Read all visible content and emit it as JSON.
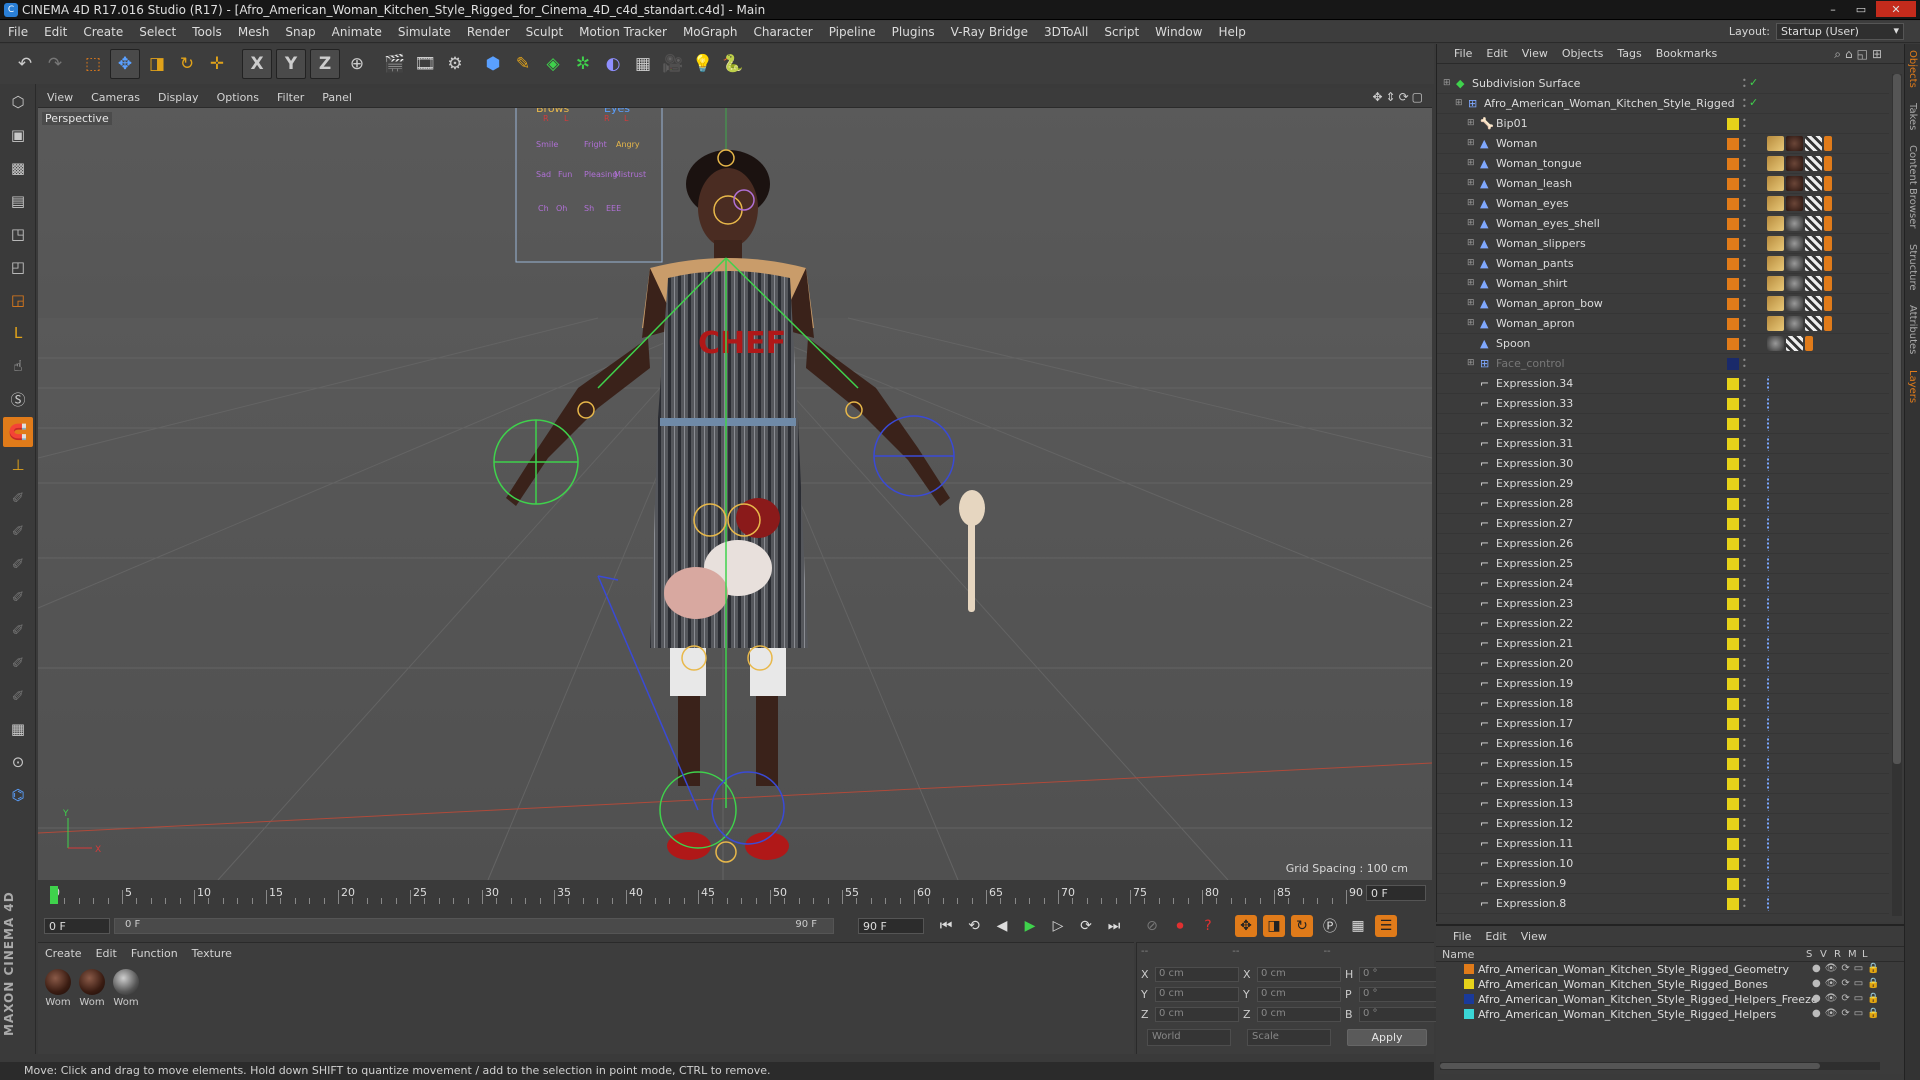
{
  "window": {
    "title": "CINEMA 4D R17.016 Studio (R17) - [Afro_American_Woman_Kitchen_Style_Rigged_for_Cinema_4D_c4d_standart.c4d] - Main"
  },
  "menu": [
    "File",
    "Edit",
    "Create",
    "Select",
    "Tools",
    "Mesh",
    "Snap",
    "Animate",
    "Simulate",
    "Render",
    "Sculpt",
    "Motion Tracker",
    "MoGraph",
    "Character",
    "Pipeline",
    "Plugins",
    "V-Ray Bridge",
    "3DToAll",
    "Script",
    "Window",
    "Help"
  ],
  "layout": {
    "label": "Layout:",
    "value": "Startup (User)"
  },
  "viewport": {
    "menu": [
      "View",
      "Cameras",
      "Display",
      "Options",
      "Filter",
      "Panel"
    ],
    "label": "Perspective",
    "grid_spacing": "Grid Spacing : 100 cm",
    "hud_labels": [
      "Brows",
      "Eyes",
      "R",
      "L",
      "R",
      "L",
      "Smile",
      "Fright",
      "Angry",
      "Sad",
      "Fun",
      "Pleasing",
      "Mistrust",
      "Ch",
      "Oh",
      "Sh",
      "EEE"
    ]
  },
  "timeline": {
    "ticks": [
      "0",
      "5",
      "10",
      "15",
      "20",
      "25",
      "30",
      "35",
      "40",
      "45",
      "50",
      "55",
      "60",
      "65",
      "70",
      "75",
      "80",
      "85",
      "90"
    ],
    "current_frame": "0 F",
    "start_field": "0 F",
    "slider_start": "0 F",
    "slider_end": "90 F",
    "end_field": "90 F"
  },
  "material": {
    "menu": [
      "Create",
      "Edit",
      "Function",
      "Texture"
    ],
    "items": [
      "Wom",
      "Wom",
      "Wom"
    ]
  },
  "coords": {
    "rows": [
      {
        "a": "X",
        "av": "0 cm",
        "b": "X",
        "bv": "0 cm",
        "c": "H",
        "cv": "0 °"
      },
      {
        "a": "Y",
        "av": "0 cm",
        "b": "Y",
        "bv": "0 cm",
        "c": "P",
        "cv": "0 °"
      },
      {
        "a": "Z",
        "av": "0 cm",
        "b": "Z",
        "bv": "0 cm",
        "c": "B",
        "cv": "0 °"
      }
    ],
    "mode": "World",
    "scale": "Scale",
    "apply": "Apply",
    "headers": [
      "--",
      "--",
      "--"
    ]
  },
  "status": "Move: Click and drag to move elements. Hold down SHIFT to quantize movement / add to the selection in point mode, CTRL to remove.",
  "brand": "MAXON CINEMA 4D",
  "objects": {
    "menu": [
      "File",
      "Edit",
      "View",
      "Objects",
      "Tags",
      "Bookmarks"
    ],
    "rows": [
      {
        "name": "Subdivision Surface",
        "indent": 0,
        "icon": "subdivision-icon",
        "color": "",
        "tags": "check"
      },
      {
        "name": "Afro_American_Woman_Kitchen_Style_Rigged",
        "indent": 1,
        "icon": "null-icon",
        "color": "",
        "tags": "check"
      },
      {
        "name": "Bip01",
        "indent": 2,
        "icon": "bone-icon",
        "color": "#e6d21a",
        "tags": ""
      },
      {
        "name": "Woman",
        "indent": 2,
        "icon": "polygon-icon",
        "color": "#e07b1a",
        "tags": "abcd"
      },
      {
        "name": "Woman_tongue",
        "indent": 2,
        "icon": "polygon-icon",
        "color": "#e07b1a",
        "tags": "abcd"
      },
      {
        "name": "Woman_leash",
        "indent": 2,
        "icon": "polygon-icon",
        "color": "#e07b1a",
        "tags": "abcd"
      },
      {
        "name": "Woman_eyes",
        "indent": 2,
        "icon": "polygon-icon",
        "color": "#e07b1a",
        "tags": "abcd"
      },
      {
        "name": "Woman_eyes_shell",
        "indent": 2,
        "icon": "polygon-icon",
        "color": "#e07b1a",
        "tags": "aecd"
      },
      {
        "name": "Woman_slippers",
        "indent": 2,
        "icon": "polygon-icon",
        "color": "#e07b1a",
        "tags": "aecd"
      },
      {
        "name": "Woman_pants",
        "indent": 2,
        "icon": "polygon-icon",
        "color": "#e07b1a",
        "tags": "aecd"
      },
      {
        "name": "Woman_shirt",
        "indent": 2,
        "icon": "polygon-icon",
        "color": "#e07b1a",
        "tags": "aecd"
      },
      {
        "name": "Woman_apron_bow",
        "indent": 2,
        "icon": "polygon-icon",
        "color": "#e07b1a",
        "tags": "aecd"
      },
      {
        "name": "Woman_apron",
        "indent": 2,
        "icon": "polygon-icon",
        "color": "#e07b1a",
        "tags": "aecd"
      },
      {
        "name": "Spoon",
        "indent": 2,
        "icon": "polygon-icon",
        "color": "#e07b1a",
        "tags": "ecd"
      },
      {
        "name": "Face_control",
        "indent": 2,
        "icon": "null-icon",
        "color": "#1a2a6a",
        "tags": "",
        "dim": true
      },
      {
        "name": "Expression.34",
        "indent": 2,
        "icon": "spline-icon",
        "color": "#e6d21a",
        "tags": "x"
      },
      {
        "name": "Expression.33",
        "indent": 2,
        "icon": "spline-icon",
        "color": "#e6d21a",
        "tags": "x"
      },
      {
        "name": "Expression.32",
        "indent": 2,
        "icon": "spline-icon",
        "color": "#e6d21a",
        "tags": "x"
      },
      {
        "name": "Expression.31",
        "indent": 2,
        "icon": "spline-icon",
        "color": "#e6d21a",
        "tags": "x"
      },
      {
        "name": "Expression.30",
        "indent": 2,
        "icon": "spline-icon",
        "color": "#e6d21a",
        "tags": "x"
      },
      {
        "name": "Expression.29",
        "indent": 2,
        "icon": "spline-icon",
        "color": "#e6d21a",
        "tags": "x"
      },
      {
        "name": "Expression.28",
        "indent": 2,
        "icon": "spline-icon",
        "color": "#e6d21a",
        "tags": "x"
      },
      {
        "name": "Expression.27",
        "indent": 2,
        "icon": "spline-icon",
        "color": "#e6d21a",
        "tags": "x"
      },
      {
        "name": "Expression.26",
        "indent": 2,
        "icon": "spline-icon",
        "color": "#e6d21a",
        "tags": "x"
      },
      {
        "name": "Expression.25",
        "indent": 2,
        "icon": "spline-icon",
        "color": "#e6d21a",
        "tags": "x"
      },
      {
        "name": "Expression.24",
        "indent": 2,
        "icon": "spline-icon",
        "color": "#e6d21a",
        "tags": "x"
      },
      {
        "name": "Expression.23",
        "indent": 2,
        "icon": "spline-icon",
        "color": "#e6d21a",
        "tags": "x"
      },
      {
        "name": "Expression.22",
        "indent": 2,
        "icon": "spline-icon",
        "color": "#e6d21a",
        "tags": "x"
      },
      {
        "name": "Expression.21",
        "indent": 2,
        "icon": "spline-icon",
        "color": "#e6d21a",
        "tags": "x"
      },
      {
        "name": "Expression.20",
        "indent": 2,
        "icon": "spline-icon",
        "color": "#e6d21a",
        "tags": "x"
      },
      {
        "name": "Expression.19",
        "indent": 2,
        "icon": "spline-icon",
        "color": "#e6d21a",
        "tags": "x"
      },
      {
        "name": "Expression.18",
        "indent": 2,
        "icon": "spline-icon",
        "color": "#e6d21a",
        "tags": "x"
      },
      {
        "name": "Expression.17",
        "indent": 2,
        "icon": "spline-icon",
        "color": "#e6d21a",
        "tags": "x"
      },
      {
        "name": "Expression.16",
        "indent": 2,
        "icon": "spline-icon",
        "color": "#e6d21a",
        "tags": "x"
      },
      {
        "name": "Expression.15",
        "indent": 2,
        "icon": "spline-icon",
        "color": "#e6d21a",
        "tags": "x"
      },
      {
        "name": "Expression.14",
        "indent": 2,
        "icon": "spline-icon",
        "color": "#e6d21a",
        "tags": "x"
      },
      {
        "name": "Expression.13",
        "indent": 2,
        "icon": "spline-icon",
        "color": "#e6d21a",
        "tags": "x"
      },
      {
        "name": "Expression.12",
        "indent": 2,
        "icon": "spline-icon",
        "color": "#e6d21a",
        "tags": "x"
      },
      {
        "name": "Expression.11",
        "indent": 2,
        "icon": "spline-icon",
        "color": "#e6d21a",
        "tags": "x"
      },
      {
        "name": "Expression.10",
        "indent": 2,
        "icon": "spline-icon",
        "color": "#e6d21a",
        "tags": "x"
      },
      {
        "name": "Expression.9",
        "indent": 2,
        "icon": "spline-icon",
        "color": "#e6d21a",
        "tags": "x"
      },
      {
        "name": "Expression.8",
        "indent": 2,
        "icon": "spline-icon",
        "color": "#e6d21a",
        "tags": "x"
      }
    ]
  },
  "layers": {
    "menu": [
      "File",
      "Edit",
      "View"
    ],
    "header": {
      "name": "Name",
      "cols": [
        "S",
        "V",
        "R",
        "M",
        "L"
      ]
    },
    "rows": [
      {
        "name": "Afro_American_Woman_Kitchen_Style_Rigged_Geometry",
        "color": "#e07b1a"
      },
      {
        "name": "Afro_American_Woman_Kitchen_Style_Rigged_Bones",
        "color": "#e6d21a"
      },
      {
        "name": "Afro_American_Woman_Kitchen_Style_Rigged_Helpers_Freeze",
        "color": "#1a3a9a"
      },
      {
        "name": "Afro_American_Woman_Kitchen_Style_Rigged_Helpers",
        "color": "#3ad6d6"
      }
    ]
  },
  "right_tabs": [
    "Objects",
    "Takes",
    "Content Browser",
    "Structure",
    "Attributes",
    "Layers"
  ]
}
